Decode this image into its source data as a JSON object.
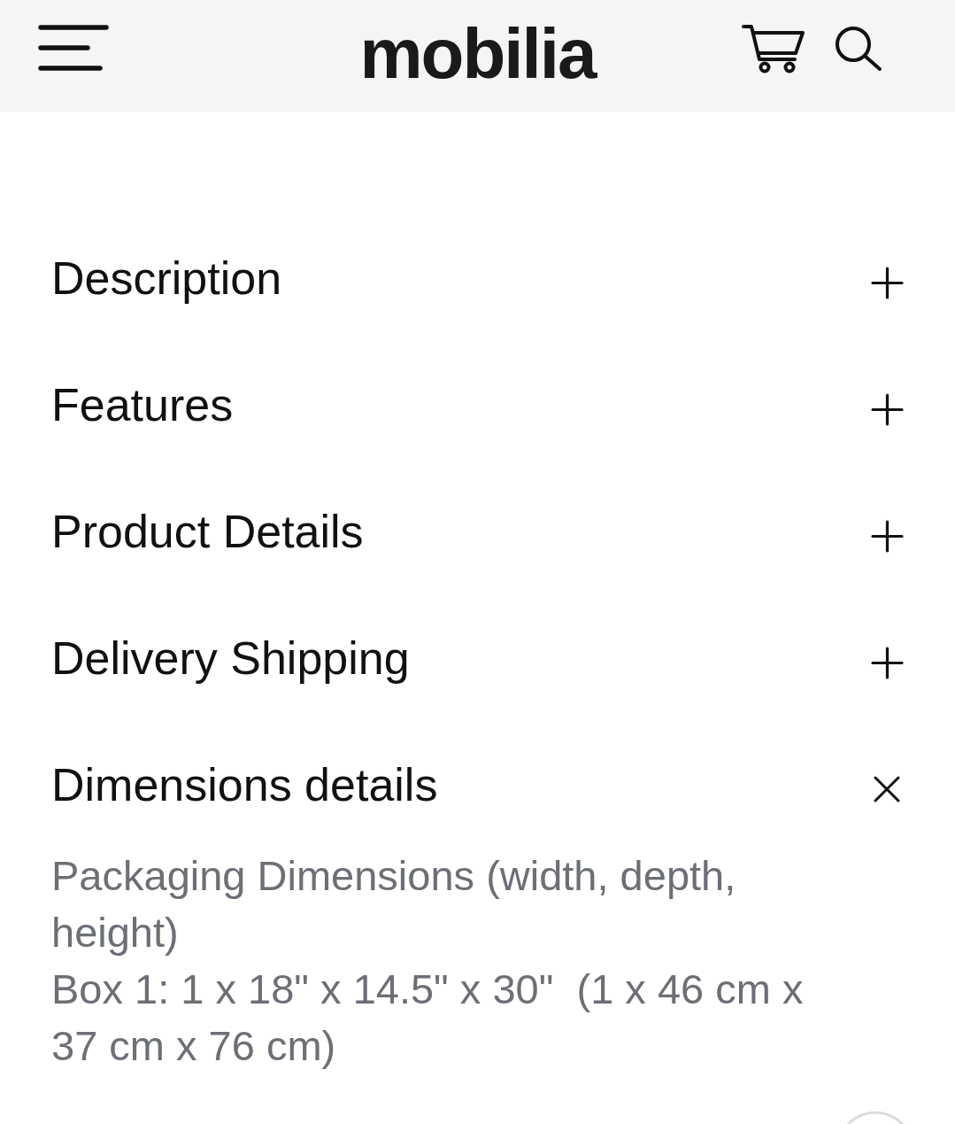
{
  "header": {
    "logo": "mobilia"
  },
  "sections": [
    {
      "title": "Description",
      "expanded": false
    },
    {
      "title": "Features",
      "expanded": false
    },
    {
      "title": "Product Details",
      "expanded": false
    },
    {
      "title": "Delivery Shipping",
      "expanded": false
    },
    {
      "title": "Dimensions details",
      "expanded": true,
      "content": [
        "Packaging Dimensions (width, depth, height)",
        "Box 1: 1 x 18\" x 14.5\" x 30\"  (1 x 46 cm x 37 cm x 76 cm)"
      ]
    }
  ]
}
